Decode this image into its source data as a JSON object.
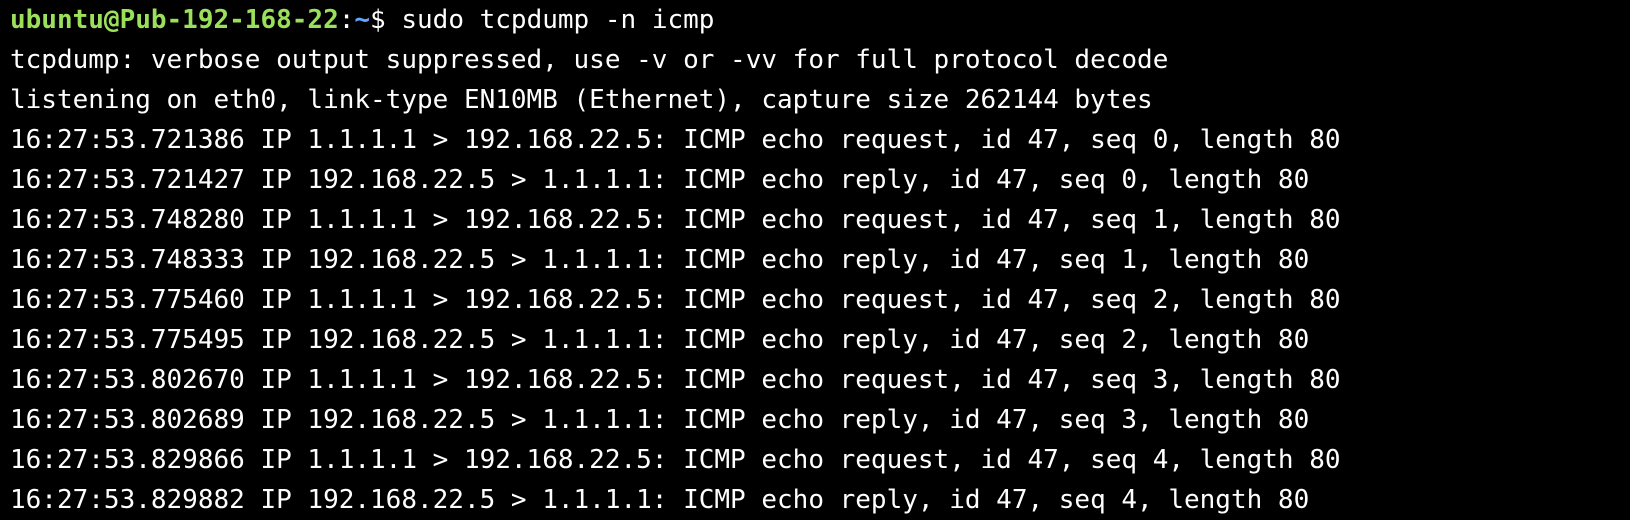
{
  "prompt": {
    "user_host": "ubuntu@Pub-192-168-22",
    "separator": ":",
    "path": "~",
    "symbol": "$ ",
    "command": "sudo tcpdump -n icmp"
  },
  "output": [
    "tcpdump: verbose output suppressed, use -v or -vv for full protocol decode",
    "listening on eth0, link-type EN10MB (Ethernet), capture size 262144 bytes",
    "16:27:53.721386 IP 1.1.1.1 > 192.168.22.5: ICMP echo request, id 47, seq 0, length 80",
    "16:27:53.721427 IP 192.168.22.5 > 1.1.1.1: ICMP echo reply, id 47, seq 0, length 80",
    "16:27:53.748280 IP 1.1.1.1 > 192.168.22.5: ICMP echo request, id 47, seq 1, length 80",
    "16:27:53.748333 IP 192.168.22.5 > 1.1.1.1: ICMP echo reply, id 47, seq 1, length 80",
    "16:27:53.775460 IP 1.1.1.1 > 192.168.22.5: ICMP echo request, id 47, seq 2, length 80",
    "16:27:53.775495 IP 192.168.22.5 > 1.1.1.1: ICMP echo reply, id 47, seq 2, length 80",
    "16:27:53.802670 IP 1.1.1.1 > 192.168.22.5: ICMP echo request, id 47, seq 3, length 80",
    "16:27:53.802689 IP 192.168.22.5 > 1.1.1.1: ICMP echo reply, id 47, seq 3, length 80",
    "16:27:53.829866 IP 1.1.1.1 > 192.168.22.5: ICMP echo request, id 47, seq 4, length 80",
    "16:27:53.829882 IP 192.168.22.5 > 1.1.1.1: ICMP echo reply, id 47, seq 4, length 80"
  ],
  "colors": {
    "background": "#000000",
    "text": "#ffffff",
    "prompt_user": "#9be05a",
    "prompt_path": "#61a6ff"
  }
}
